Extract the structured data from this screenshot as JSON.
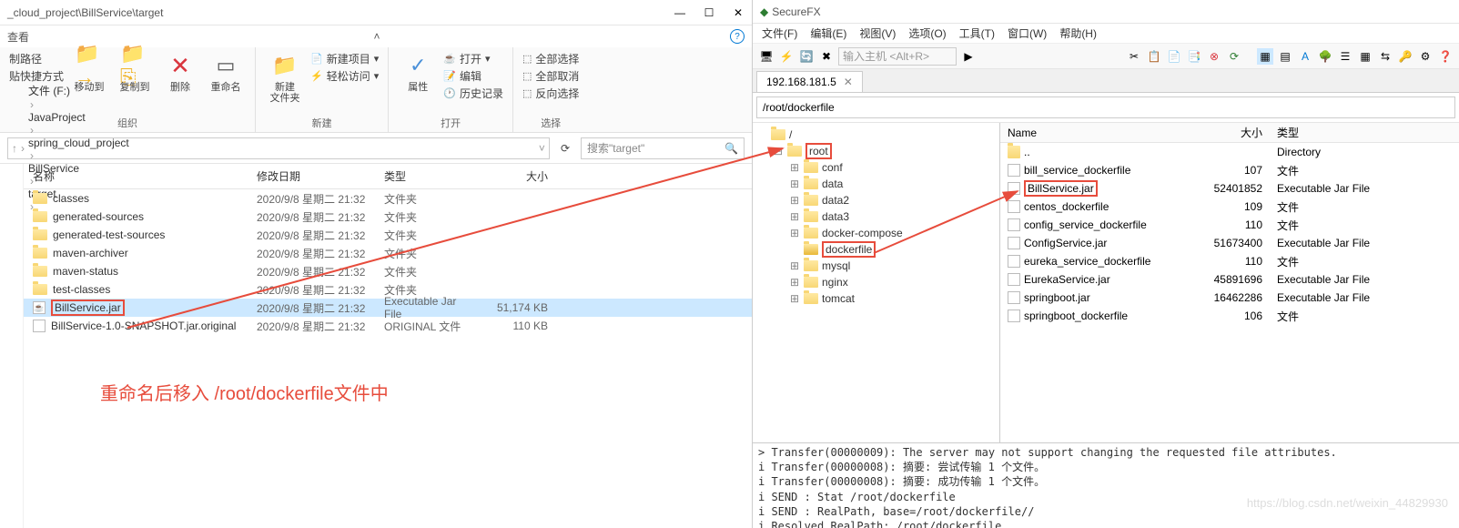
{
  "explorer": {
    "title_path": "_cloud_project\\BillService\\target",
    "subbar_text": "查看",
    "ribbon": {
      "col1_label": "制路径",
      "col1_label2": "贴快捷方式",
      "btn_move": "移动到",
      "btn_copy": "复制到",
      "btn_delete": "删除",
      "btn_rename": "重命名",
      "group1": "组织",
      "btn_newfolder": "新建\n文件夹",
      "new_item": "新建项目",
      "easy_access": "轻松访问",
      "group2": "新建",
      "btn_props": "属性",
      "open": "打开",
      "edit": "编辑",
      "history": "历史记录",
      "group3": "打开",
      "select_all": "全部选择",
      "select_none": "全部取消",
      "select_inv": "反向选择",
      "group4": "选择"
    },
    "breadcrumb": [
      "文件 (F:)",
      "JavaProject",
      "spring_cloud_project",
      "BillService",
      "target"
    ],
    "search_placeholder": "搜索\"target\"",
    "columns": {
      "name": "名称",
      "date": "修改日期",
      "type": "类型",
      "size": "大小"
    },
    "rows": [
      {
        "icon": "folder",
        "name": "classes",
        "date": "2020/9/8 星期二 21:32",
        "type": "文件夹",
        "size": ""
      },
      {
        "icon": "folder",
        "name": "generated-sources",
        "date": "2020/9/8 星期二 21:32",
        "type": "文件夹",
        "size": ""
      },
      {
        "icon": "folder",
        "name": "generated-test-sources",
        "date": "2020/9/8 星期二 21:32",
        "type": "文件夹",
        "size": ""
      },
      {
        "icon": "folder",
        "name": "maven-archiver",
        "date": "2020/9/8 星期二 21:32",
        "type": "文件夹",
        "size": ""
      },
      {
        "icon": "folder",
        "name": "maven-status",
        "date": "2020/9/8 星期二 21:32",
        "type": "文件夹",
        "size": ""
      },
      {
        "icon": "folder",
        "name": "test-classes",
        "date": "2020/9/8 星期二 21:32",
        "type": "文件夹",
        "size": ""
      },
      {
        "icon": "jar",
        "name": "BillService.jar",
        "date": "2020/9/8 星期二 21:32",
        "type": "Executable Jar File",
        "size": "51,174 KB",
        "selected": true,
        "boxed": true
      },
      {
        "icon": "file",
        "name": "BillService-1.0-SNAPSHOT.jar.original",
        "date": "2020/9/8 星期二 21:32",
        "type": "ORIGINAL 文件",
        "size": "110 KB"
      }
    ],
    "annotation": "重命名后移入 /root/dockerfile文件中"
  },
  "securefx": {
    "app_title": "SecureFX",
    "menu": [
      "文件(F)",
      "编辑(E)",
      "视图(V)",
      "选项(O)",
      "工具(T)",
      "窗口(W)",
      "帮助(H)"
    ],
    "host_placeholder": "输入主机 <Alt+R>",
    "tab": "192.168.181.5",
    "path": "/root/dockerfile",
    "tree": [
      {
        "depth": 0,
        "exp": "",
        "label": "/",
        "folder": true
      },
      {
        "depth": 1,
        "exp": "-",
        "label": "root",
        "folder": true,
        "boxed": true
      },
      {
        "depth": 2,
        "exp": "+",
        "label": "conf",
        "folder": true
      },
      {
        "depth": 2,
        "exp": "+",
        "label": "data",
        "folder": true
      },
      {
        "depth": 2,
        "exp": "+",
        "label": "data2",
        "folder": true
      },
      {
        "depth": 2,
        "exp": "+",
        "label": "data3",
        "folder": true
      },
      {
        "depth": 2,
        "exp": "+",
        "label": "docker-compose",
        "folder": true
      },
      {
        "depth": 2,
        "exp": "",
        "label": "dockerfile",
        "folder": true,
        "boxed": true,
        "open": true
      },
      {
        "depth": 2,
        "exp": "+",
        "label": "mysql",
        "folder": true
      },
      {
        "depth": 2,
        "exp": "+",
        "label": "nginx",
        "folder": true
      },
      {
        "depth": 2,
        "exp": "+",
        "label": "tomcat",
        "folder": true
      }
    ],
    "cols": {
      "name": "Name",
      "size": "大小",
      "type": "类型"
    },
    "files": [
      {
        "icon": "folder",
        "name": "..",
        "size": "",
        "type": "Directory"
      },
      {
        "icon": "file",
        "name": "bill_service_dockerfile",
        "size": "107",
        "type": "文件"
      },
      {
        "icon": "file",
        "name": "BillService.jar",
        "size": "52401852",
        "type": "Executable Jar File",
        "boxed": true
      },
      {
        "icon": "file",
        "name": "centos_dockerfile",
        "size": "109",
        "type": "文件"
      },
      {
        "icon": "file",
        "name": "config_service_dockerfile",
        "size": "110",
        "type": "文件"
      },
      {
        "icon": "file",
        "name": "ConfigService.jar",
        "size": "51673400",
        "type": "Executable Jar File"
      },
      {
        "icon": "file",
        "name": "eureka_service_dockerfile",
        "size": "110",
        "type": "文件"
      },
      {
        "icon": "file",
        "name": "EurekaService.jar",
        "size": "45891696",
        "type": "Executable Jar File"
      },
      {
        "icon": "file",
        "name": "springboot.jar",
        "size": "16462286",
        "type": "Executable Jar File"
      },
      {
        "icon": "file",
        "name": "springboot_dockerfile",
        "size": "106",
        "type": "文件"
      }
    ],
    "log": "> Transfer(00000009): The server may not support changing the requested file attributes.\ni Transfer(00000008): 摘要: 尝试传输 1 个文件。\ni Transfer(00000008): 摘要: 成功传输 1 个文件。\ni SEND : Stat /root/dockerfile\ni SEND : RealPath, base=/root/dockerfile//\ni Resolved RealPath: /root/dockerfile",
    "watermark": "https://blog.csdn.net/weixin_44829930"
  }
}
